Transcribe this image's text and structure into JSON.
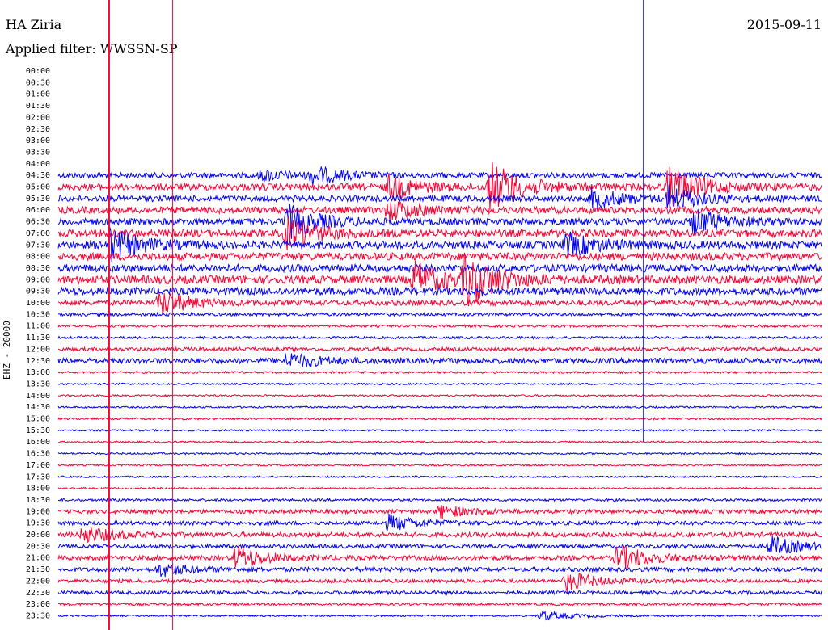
{
  "header": {
    "station": "HA Ziria",
    "filter": "Applied filter: WWSSN-SP",
    "date": "2015-09-11",
    "channel": "EHZ - 20000"
  },
  "colors": {
    "odd": "#0000ff",
    "even": "#ff0033",
    "grid": "#ff0033",
    "mark": "#0000ff"
  },
  "chart_data": {
    "type": "line",
    "title": "HA Ziria",
    "ylabel": "EHZ - 20000",
    "date": "2015-09-11",
    "filter": "WWSSN-SP",
    "rows": [
      "00:00",
      "00:30",
      "01:00",
      "01:30",
      "02:00",
      "02:30",
      "03:00",
      "03:30",
      "04:00",
      "04:30",
      "05:00",
      "05:30",
      "06:00",
      "06:30",
      "07:00",
      "07:30",
      "08:00",
      "08:30",
      "09:00",
      "09:30",
      "10:00",
      "10:30",
      "11:00",
      "11:30",
      "12:00",
      "12:30",
      "13:00",
      "13:30",
      "14:00",
      "14:30",
      "15:00",
      "15:30",
      "16:00",
      "16:30",
      "17:00",
      "17:30",
      "18:00",
      "18:30",
      "19:00",
      "19:30",
      "20:00",
      "20:30",
      "21:00",
      "21:30",
      "22:00",
      "22:30",
      "23:00",
      "23:30"
    ],
    "first_trace_row": 9,
    "noise_level": [
      0,
      0,
      0,
      0,
      0,
      0,
      0,
      0,
      0,
      0.6,
      0.8,
      0.7,
      0.8,
      0.8,
      0.9,
      0.9,
      0.9,
      0.9,
      1.0,
      0.9,
      0.6,
      0.3,
      0.2,
      0.2,
      0.35,
      0.6,
      0.15,
      0.1,
      0.1,
      0.1,
      0.15,
      0.1,
      0.1,
      0.1,
      0.1,
      0.1,
      0.1,
      0.2,
      0.4,
      0.4,
      0.5,
      0.4,
      0.5,
      0.45,
      0.35,
      0.35,
      0.2,
      0.1
    ],
    "events": [
      {
        "row": 9,
        "minute": 8,
        "amp": 6
      },
      {
        "row": 9,
        "minute": 10,
        "amp": 10
      },
      {
        "row": 10,
        "minute": 13,
        "amp": 14
      },
      {
        "row": 10,
        "minute": 17,
        "amp": 30
      },
      {
        "row": 10,
        "minute": 24,
        "amp": 25
      },
      {
        "row": 11,
        "minute": 21,
        "amp": 12
      },
      {
        "row": 11,
        "minute": 24,
        "amp": 14
      },
      {
        "row": 12,
        "minute": 13,
        "amp": 12
      },
      {
        "row": 13,
        "minute": 9,
        "amp": 20
      },
      {
        "row": 13,
        "minute": 25,
        "amp": 15
      },
      {
        "row": 14,
        "minute": 9,
        "amp": 18
      },
      {
        "row": 15,
        "minute": 2,
        "amp": 20
      },
      {
        "row": 15,
        "minute": 20,
        "amp": 14
      },
      {
        "row": 18,
        "minute": 14,
        "amp": 20
      },
      {
        "row": 18,
        "minute": 16,
        "amp": 30
      },
      {
        "row": 20,
        "minute": 4,
        "amp": 14
      },
      {
        "row": 25,
        "minute": 9,
        "amp": 10
      },
      {
        "row": 38,
        "minute": 15,
        "amp": 8
      },
      {
        "row": 39,
        "minute": 13,
        "amp": 10
      },
      {
        "row": 40,
        "minute": 1,
        "amp": 10
      },
      {
        "row": 41,
        "minute": 28,
        "amp": 12
      },
      {
        "row": 42,
        "minute": 7,
        "amp": 14
      },
      {
        "row": 42,
        "minute": 22,
        "amp": 16
      },
      {
        "row": 43,
        "minute": 4,
        "amp": 8
      },
      {
        "row": 44,
        "minute": 20,
        "amp": 12
      },
      {
        "row": 47,
        "minute": 19,
        "amp": 6
      }
    ],
    "markers": [
      {
        "minute": 2.0,
        "color": "even",
        "from_row": 0,
        "to_row": 47
      },
      {
        "minute": 4.5,
        "color": "even",
        "from_row": 0,
        "to_row": 47
      },
      {
        "minute": 23.0,
        "color": "odd",
        "from_row": 0,
        "to_row": 32
      }
    ],
    "xlim": [
      0,
      30
    ],
    "grid": false,
    "legend": "none"
  }
}
